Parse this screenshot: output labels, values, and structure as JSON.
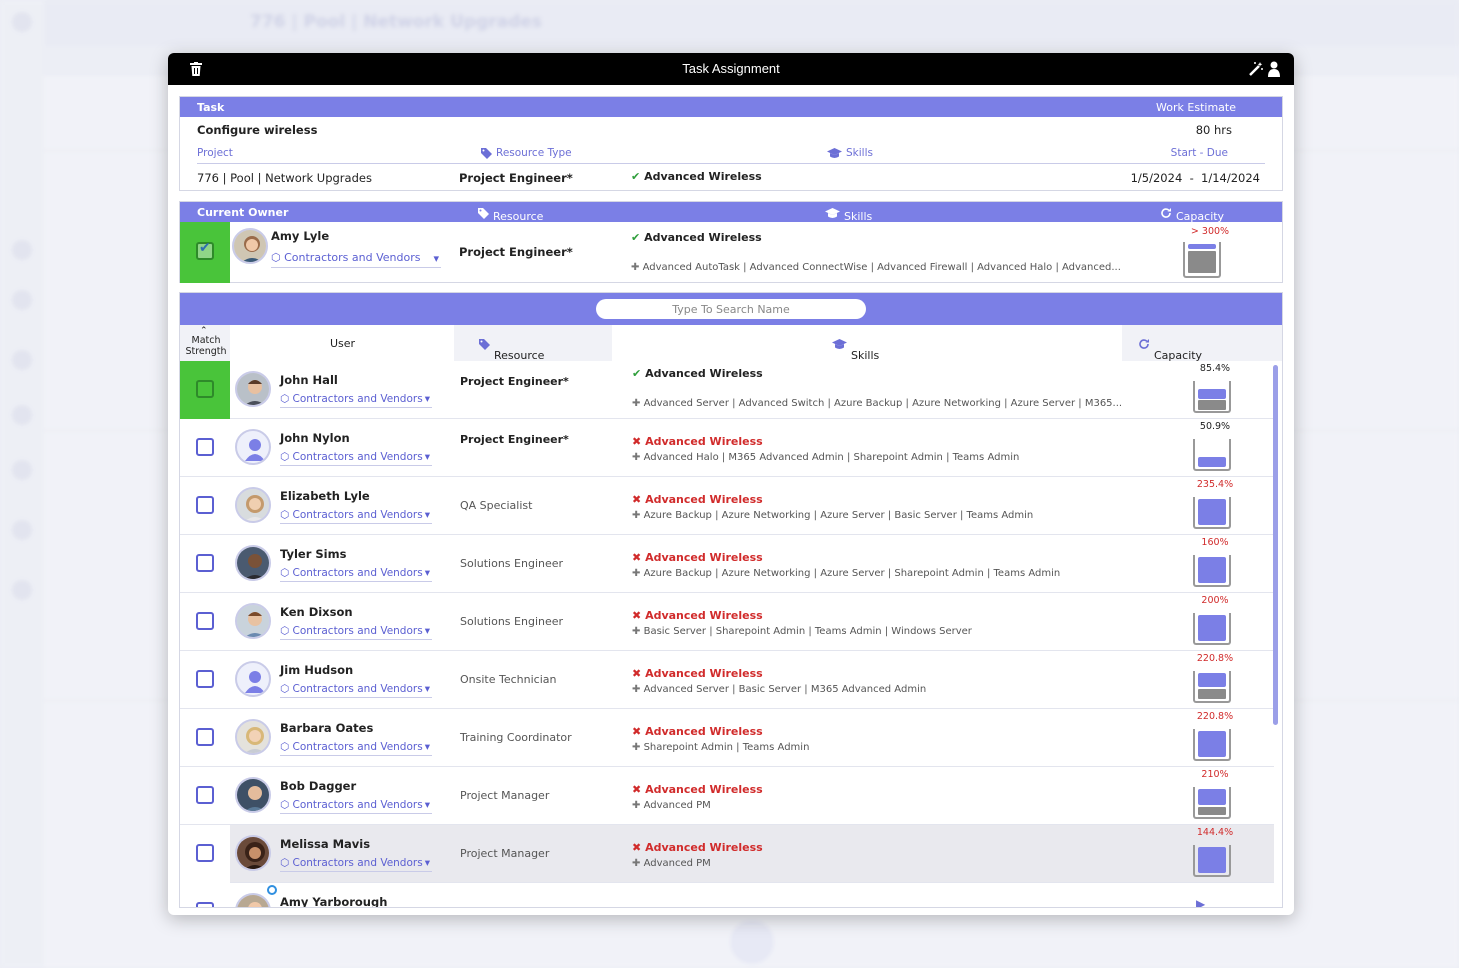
{
  "background": {
    "title": "776 | Pool | Network Upgrades"
  },
  "modal": {
    "title": "Task Assignment"
  },
  "task": {
    "header_task": "Task",
    "header_estimate": "Work Estimate",
    "name": "Configure wireless",
    "estimate": "80 hrs",
    "label_project": "Project",
    "label_resource_type": "Resource Type",
    "label_skills": "Skills",
    "label_dates": "Start - Due",
    "project": "776 | Pool | Network Upgrades",
    "resource_type": "Project Engineer*",
    "skill": "Advanced Wireless",
    "dates": "1/5/2024  -  1/14/2024"
  },
  "owner": {
    "header_owner": "Current Owner",
    "header_resource_type": "Resource Type",
    "header_skills": "Skills",
    "header_capacity": "Capacity",
    "name": "Amy Lyle",
    "vendor": "Contractors and Vendors",
    "resource_type": "Project Engineer*",
    "skill": "Advanced Wireless",
    "more_skills": "Advanced AutoTask | Advanced ConnectWise | Advanced Firewall | Advanced Halo | Advanced...",
    "capacity": "> 300%"
  },
  "list": {
    "search_placeholder": "Type To Search Name",
    "col_match": "Match Strength",
    "col_user": "User",
    "col_resource_type": "Resource Type",
    "col_skills": "Skills",
    "col_capacity": "Capacity incl. Task",
    "rows": [
      {
        "name": "John Hall",
        "vendor": "Contractors and Vendors",
        "rtype": "Project Engineer*",
        "skill": "Advanced Wireless",
        "more": "Advanced Server | Advanced Switch | Azure Backup | Azure Networking | Azure Server | M365...",
        "cap": "85.4%"
      },
      {
        "name": "John Nylon",
        "vendor": "Contractors and Vendors",
        "rtype": "Project Engineer*",
        "skill": "Advanced Wireless",
        "more": "Advanced Halo | M365 Advanced Admin | Sharepoint Admin | Teams Admin",
        "cap": "50.9%"
      },
      {
        "name": "Elizabeth Lyle",
        "vendor": "Contractors and Vendors",
        "rtype": "QA Specialist",
        "skill": "Advanced Wireless",
        "more": "Azure Backup | Azure Networking | Azure Server | Basic Server | Teams Admin",
        "cap": "235.4%"
      },
      {
        "name": "Tyler Sims",
        "vendor": "Contractors and Vendors",
        "rtype": "Solutions Engineer",
        "skill": "Advanced Wireless",
        "more": "Azure Backup | Azure Networking | Azure Server | Sharepoint Admin | Teams Admin",
        "cap": "160%"
      },
      {
        "name": "Ken Dixson",
        "vendor": "Contractors and Vendors",
        "rtype": "Solutions Engineer",
        "skill": "Advanced Wireless",
        "more": "Basic Server | Sharepoint Admin | Teams Admin | Windows Server",
        "cap": "200%"
      },
      {
        "name": "Jim Hudson",
        "vendor": "Contractors and Vendors",
        "rtype": "Onsite Technician",
        "skill": "Advanced Wireless",
        "more": "Advanced Server | Basic Server | M365 Advanced Admin",
        "cap": "220.8%"
      },
      {
        "name": "Barbara Oates",
        "vendor": "Contractors and Vendors",
        "rtype": "Training Coordinator",
        "skill": "Advanced Wireless",
        "more": "Sharepoint Admin | Teams Admin",
        "cap": "220.8%"
      },
      {
        "name": "Bob Dagger",
        "vendor": "Contractors and Vendors",
        "rtype": "Project Manager",
        "skill": "Advanced Wireless",
        "more": "Advanced PM",
        "cap": "210%"
      },
      {
        "name": "Melissa Mavis",
        "vendor": "Contractors and Vendors",
        "rtype": "Project Manager",
        "skill": "Advanced Wireless",
        "more": "Advanced PM",
        "cap": "144.4%"
      },
      {
        "name": "Amy Yarborough"
      }
    ]
  },
  "colors": {
    "accent": "#7b7fe6",
    "match_green": "#49c43a",
    "mismatch_red": "#d12b2b"
  }
}
